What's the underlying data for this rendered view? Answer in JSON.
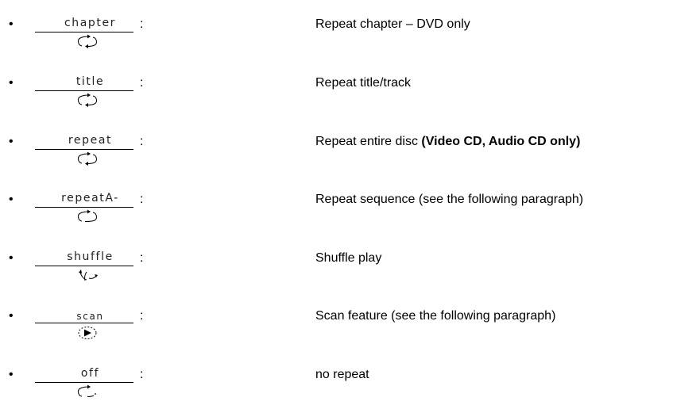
{
  "items": [
    {
      "label": "chapter",
      "colon": ":",
      "icon": "repeat-icon",
      "desc": "Repeat chapter – DVD only",
      "desc_bold": ""
    },
    {
      "label": "title",
      "colon": ":",
      "icon": "repeat-icon",
      "desc": "Repeat title/track",
      "desc_bold": ""
    },
    {
      "label": "repeat",
      "colon": ":",
      "icon": "repeat-icon",
      "desc": "Repeat entire disc ",
      "desc_bold": "(Video CD, Audio CD only)"
    },
    {
      "label": "repeatA-",
      "colon": ":",
      "icon": "repeat-ab-icon",
      "desc": "Repeat sequence (see the following paragraph)",
      "desc_bold": ""
    },
    {
      "label": "shuffle",
      "colon": ":",
      "icon": "shuffle-icon",
      "desc": "Shuffle play",
      "desc_bold": ""
    },
    {
      "label": "scan",
      "colon": ":",
      "icon": "scan-icon",
      "desc": "Scan feature (see the following paragraph)",
      "desc_bold": ""
    },
    {
      "label": "off",
      "colon": ":",
      "icon": "repeat-off-icon",
      "desc": "no repeat",
      "desc_bold": ""
    }
  ]
}
